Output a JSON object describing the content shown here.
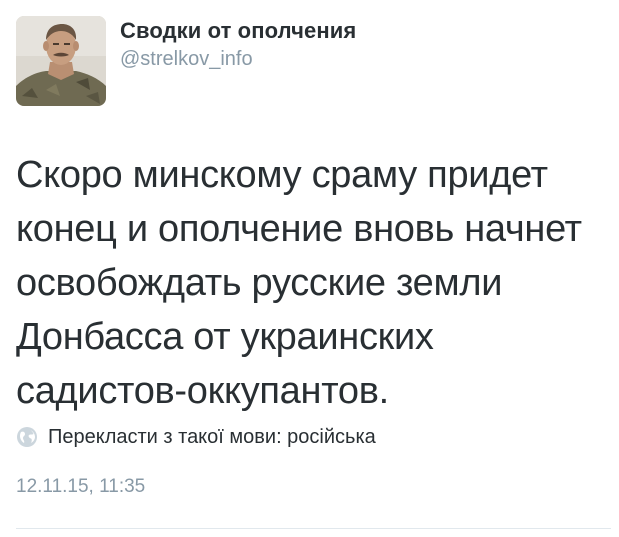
{
  "author": {
    "display_name": "Сводки от ополчения",
    "handle": "@strelkov_info",
    "avatar_icon": "profile-photo"
  },
  "tweet": {
    "lines": [
      "Скоро минскому сраму придет",
      "конец и ополчение вновь начнет",
      "освобождать русские земли",
      "Донбасса от украинских",
      "садистов-оккупантов."
    ]
  },
  "translate": {
    "icon": "globe-icon",
    "label": "Перекласти з такої мови: російська"
  },
  "timestamp": "12.11.15, 11:35",
  "colors": {
    "text": "#292f33",
    "muted": "#8899a6",
    "divider": "#e1e8ed"
  }
}
